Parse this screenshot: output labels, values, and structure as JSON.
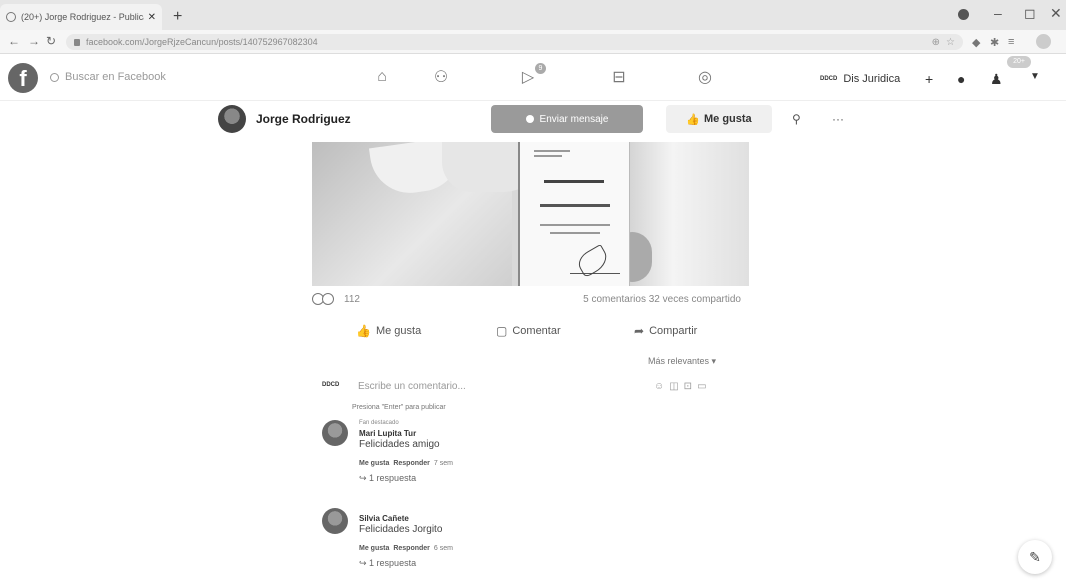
{
  "browser": {
    "tab_title": "(20+) Jorge Rodriguez - Publica...",
    "tab_close": "✕",
    "new_tab": "+",
    "url": "facebook.com/JorgeRjzeCancun/posts/140752967082304",
    "controls": {
      "minimize": "–",
      "maximize": "◻",
      "close": "✕"
    }
  },
  "header": {
    "logo": "f",
    "search_placeholder": "Buscar en Facebook",
    "watch_badge": "9",
    "notifications_badge": "20+",
    "account_logo": "DDCD",
    "account_name": "Dis Juridica",
    "create": "+"
  },
  "profile": {
    "name": "Jorge Rodriguez",
    "send_message": "Enviar mensaje",
    "like_page": "Me gusta",
    "more": "···"
  },
  "post": {
    "reactions_count": "112",
    "comments_shares": "5 comentarios 32 veces compartido",
    "action_like": "Me gusta",
    "action_comment": "Comentar",
    "action_share": "Compartir",
    "sort": "Más relevantes ▾",
    "comment_placeholder": "Escribe un comentario...",
    "comment_hint": "Presiona \"Enter\" para publicar",
    "commenter_logo": "DDCD"
  },
  "comments": [
    {
      "tag": "Fan destacado",
      "author": "Mari Lupita Tur",
      "text": "Felicidades amigo",
      "like": "Me gusta",
      "reply": "Responder",
      "time": "7 sem",
      "replies": "1 respuesta"
    },
    {
      "tag": "",
      "author": "Silvia Cañete",
      "text": "Felicidades Jorgito",
      "like": "Me gusta",
      "reply": "Responder",
      "time": "6 sem",
      "replies": "1 respuesta"
    }
  ],
  "icons": {
    "home": "home-icon",
    "friends": "friends-icon",
    "watch": "watch-icon",
    "marketplace": "marketplace-icon",
    "groups": "groups-icon",
    "messenger": "messenger-icon",
    "bell": "bell-icon",
    "compose": "compose-icon"
  }
}
